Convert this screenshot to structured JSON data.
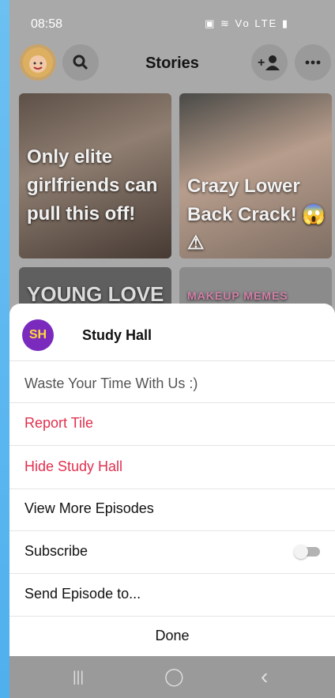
{
  "status": {
    "time": "08:58",
    "icons": "▣ ≋ Vo LTE ▮"
  },
  "header": {
    "title": "Stories"
  },
  "tiles": [
    {
      "caption": "Only elite girlfriends can pull this off!"
    },
    {
      "caption": "Crazy Lower Back Crack! 😱⚠"
    },
    {
      "caption": "YOUNG LOVE"
    },
    {
      "caption": "MAKEUP MEMES"
    }
  ],
  "sheet": {
    "channel_name": "Study Hall",
    "channel_logo": "SH",
    "tagline": "Waste Your Time With Us :)",
    "report": "Report Tile",
    "hide": "Hide Study Hall",
    "more": "View More Episodes",
    "subscribe": "Subscribe",
    "send": "Send Episode to...",
    "done": "Done",
    "subscribe_on": false
  },
  "nav": {
    "recents": "|||",
    "home": "◯",
    "back": "‹"
  },
  "colors": {
    "danger": "#e0304e",
    "bg": "#6ec0f0"
  }
}
